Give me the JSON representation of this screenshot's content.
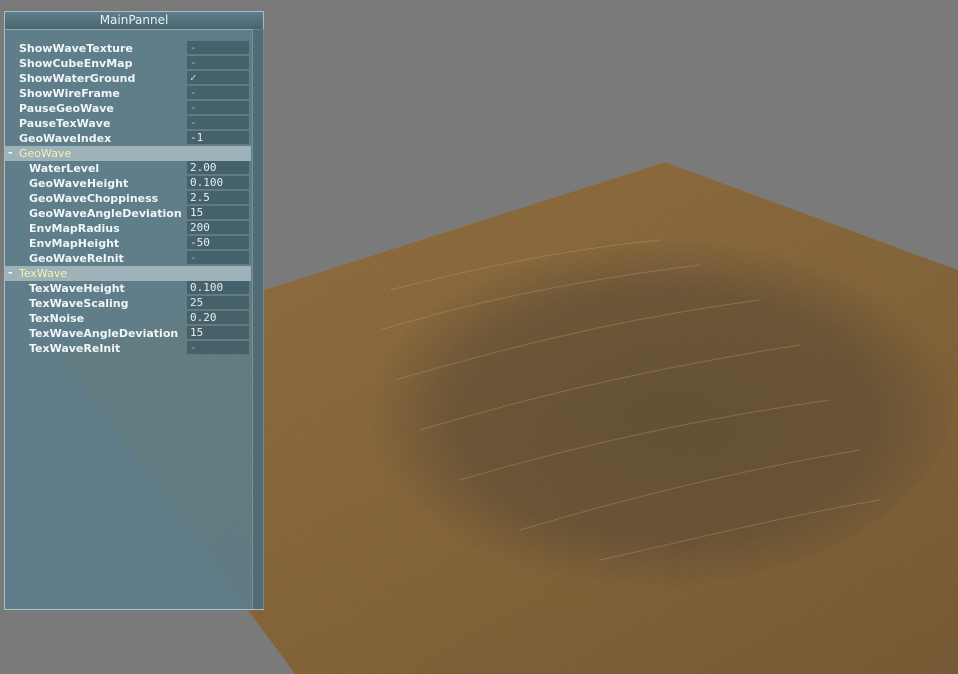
{
  "window": {
    "title": "MainPannel"
  },
  "settings": [
    {
      "label": "ShowWaveTexture",
      "value": "-"
    },
    {
      "label": "ShowCubeEnvMap",
      "value": "-"
    },
    {
      "label": "ShowWaterGround",
      "value": "✓"
    },
    {
      "label": "ShowWireFrame",
      "value": "-"
    },
    {
      "label": "PauseGeoWave",
      "value": "-"
    },
    {
      "label": "PauseTexWave",
      "value": "-"
    },
    {
      "label": "GeoWaveIndex",
      "value": "-1"
    }
  ],
  "geowave": {
    "toggle": "-",
    "label": "GeoWave",
    "items": [
      {
        "label": "WaterLevel",
        "value": "2.00"
      },
      {
        "label": "GeoWaveHeight",
        "value": "0.100"
      },
      {
        "label": "GeoWaveChoppiness",
        "value": "2.5"
      },
      {
        "label": "GeoWaveAngleDeviation",
        "value": "15"
      },
      {
        "label": "EnvMapRadius",
        "value": "200"
      },
      {
        "label": "EnvMapHeight",
        "value": "-50"
      },
      {
        "label": "GeoWaveReInit",
        "value": "-"
      }
    ]
  },
  "texwave": {
    "toggle": "-",
    "label": "TexWave",
    "items": [
      {
        "label": "TexWaveHeight",
        "value": "0.100"
      },
      {
        "label": "TexWaveScaling",
        "value": "25"
      },
      {
        "label": "TexNoise",
        "value": "0.20"
      },
      {
        "label": "TexWaveAngleDeviation",
        "value": "15"
      },
      {
        "label": "TexWaveReInit",
        "value": "-"
      }
    ]
  },
  "colors": {
    "background": "#7a7a7a",
    "terrain": "#8a6a40",
    "panel": "#5c7e8c",
    "group_header": "#9eb2ba"
  }
}
